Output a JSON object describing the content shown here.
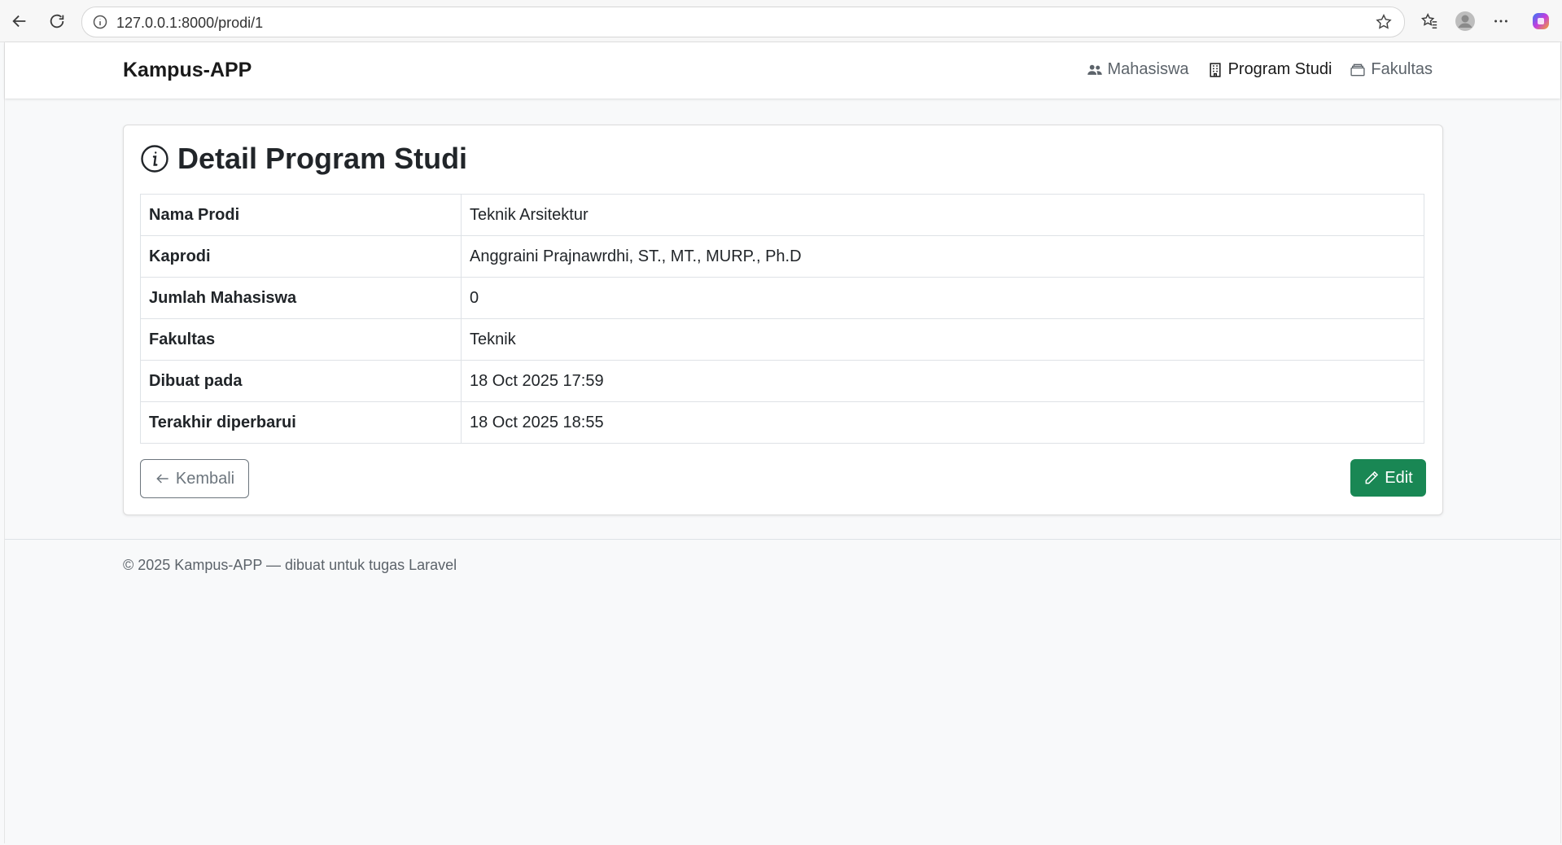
{
  "browser": {
    "url": "127.0.0.1:8000/prodi/1"
  },
  "navbar": {
    "brand": "Kampus-APP",
    "links": [
      {
        "label": "Mahasiswa",
        "icon": "people-icon",
        "active": false
      },
      {
        "label": "Program Studi",
        "icon": "building-icon",
        "active": true
      },
      {
        "label": "Fakultas",
        "icon": "archive-icon",
        "active": false
      }
    ]
  },
  "card": {
    "title": "Detail Program Studi",
    "rows": [
      {
        "label": "Nama Prodi",
        "value": "Teknik Arsitektur"
      },
      {
        "label": "Kaprodi",
        "value": "Anggraini Prajnawrdhi, ST., MT., MURP., Ph.D"
      },
      {
        "label": "Jumlah Mahasiswa",
        "value": "0"
      },
      {
        "label": "Fakultas",
        "value": "Teknik"
      },
      {
        "label": "Dibuat pada",
        "value": "18 Oct 2025 17:59"
      },
      {
        "label": "Terakhir diperbarui",
        "value": "18 Oct 2025 18:55"
      }
    ],
    "back_label": "Kembali",
    "edit_label": "Edit"
  },
  "footer": {
    "text": "© 2025 Kampus-APP — dibuat untuk tugas Laravel"
  },
  "colors": {
    "edit_button": "#198754",
    "background": "#f8f9fa"
  }
}
